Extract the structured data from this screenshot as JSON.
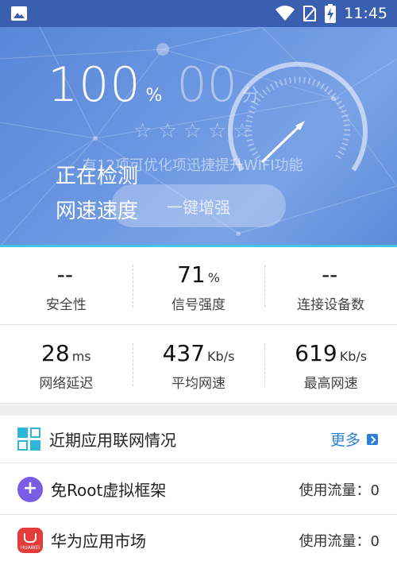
{
  "status_bar": {
    "time": "11:45",
    "icons": [
      "image-icon",
      "wifi-icon",
      "sim-icon",
      "battery-charging-icon"
    ]
  },
  "hero": {
    "score_value": "100",
    "score_unit": "%",
    "grade_value": "00",
    "grade_unit": "分",
    "stars": 5,
    "detect_line1": "正在检测",
    "detect_line2": "网速速度",
    "hint": "有12项可优化项迅捷提升WIFI功能",
    "boost_button": "一键增强",
    "colors": {
      "bg": "#6a95e0",
      "accent_line": "#43c6e6"
    }
  },
  "stats": {
    "row1": [
      {
        "value": "--",
        "unit": "",
        "label": "安全性"
      },
      {
        "value": "71",
        "unit": "%",
        "label": "信号强度"
      },
      {
        "value": "--",
        "unit": "",
        "label": "连接设备数"
      }
    ],
    "row2": [
      {
        "value": "28",
        "unit": "ms",
        "label": "网络延迟"
      },
      {
        "value": "437",
        "unit": "Kb/s",
        "label": "平均网速"
      },
      {
        "value": "619",
        "unit": "Kb/s",
        "label": "最高网速"
      }
    ]
  },
  "list": {
    "recent": {
      "title": "近期应用联网情况",
      "more": "更多"
    },
    "items": [
      {
        "title": "免Root虚拟框架",
        "usage": "使用流量：0",
        "icon": "plus-circle-icon"
      },
      {
        "title": "华为应用市场",
        "usage": "使用流量：0",
        "icon": "huawei-appgallery-icon",
        "brand": "HUAWEI"
      }
    ]
  }
}
